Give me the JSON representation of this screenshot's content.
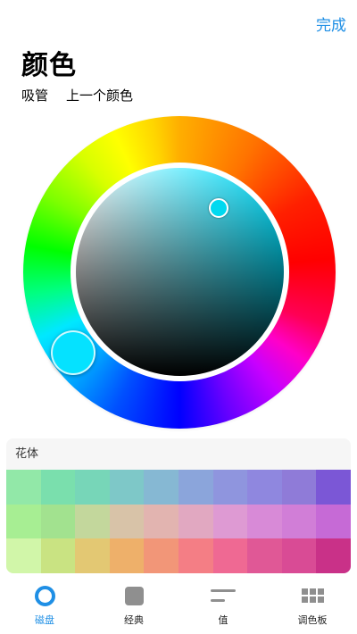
{
  "header": {
    "done_label": "完成",
    "title": "颜色",
    "eyedropper_label": "吸管",
    "previous_color_label": "上一个颜色"
  },
  "picker": {
    "selected_hue": "#05e2ff",
    "sv_thumb_color": "#00d9f0"
  },
  "palette": {
    "title": "花体",
    "rows": [
      [
        "#92e8a8",
        "#7adfad",
        "#77d6b8",
        "#7ec8c8",
        "#86b8d3",
        "#8ba5db",
        "#8f95de",
        "#8f87df",
        "#8f7bd8",
        "#7b57d6"
      ],
      [
        "#a7ee93",
        "#a2e28f",
        "#c3d79c",
        "#d8c3a8",
        "#e2b4b0",
        "#e1a8c1",
        "#de9ad3",
        "#d88ad7",
        "#d17ed7",
        "#c66ad6"
      ],
      [
        "#d1f6a9",
        "#c9e382",
        "#e3c873",
        "#eeb06a",
        "#f29678",
        "#f47e85",
        "#ef6993",
        "#e05896",
        "#d94b95",
        "#c93188"
      ]
    ]
  },
  "tabs": [
    {
      "label": "磁盘",
      "icon": "color-disk-icon",
      "active": true
    },
    {
      "label": "经典",
      "icon": "square-icon",
      "active": false
    },
    {
      "label": "值",
      "icon": "sliders-icon",
      "active": false
    },
    {
      "label": "调色板",
      "icon": "grid-icon",
      "active": false
    }
  ],
  "colors": {
    "accent": "#1f8fe5"
  }
}
